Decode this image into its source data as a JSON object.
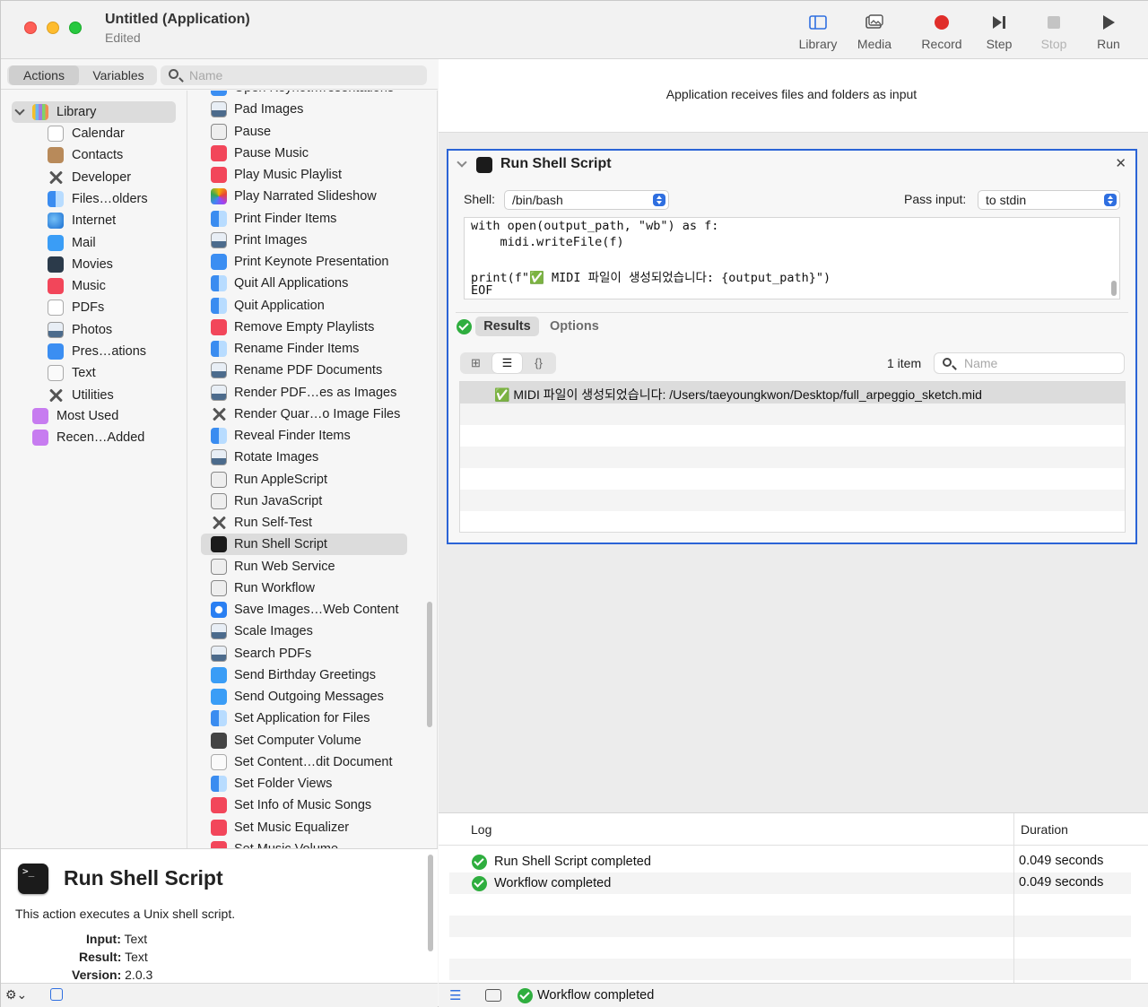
{
  "window": {
    "title": "Untitled (Application)",
    "subtitle": "Edited"
  },
  "toolbar": {
    "buttons": [
      {
        "label": "Library",
        "icon": "sidebar-icon",
        "enabled": true
      },
      {
        "label": "Media",
        "icon": "photo-icon",
        "enabled": true
      },
      {
        "label": "Record",
        "icon": "record-icon",
        "enabled": true
      },
      {
        "label": "Step",
        "icon": "step-icon",
        "enabled": true
      },
      {
        "label": "Stop",
        "icon": "stop-icon",
        "enabled": false
      },
      {
        "label": "Run",
        "icon": "play-icon",
        "enabled": true
      }
    ]
  },
  "left_tabs": {
    "actions": "Actions",
    "variables": "Variables",
    "search_placeholder": "Name"
  },
  "library": {
    "root": "Library",
    "items": [
      {
        "label": "Calendar",
        "icon": "calendar-icon"
      },
      {
        "label": "Contacts",
        "icon": "contacts-icon"
      },
      {
        "label": "Developer",
        "icon": "tools-icon"
      },
      {
        "label": "Files…olders",
        "icon": "finder-icon"
      },
      {
        "label": "Internet",
        "icon": "globe-icon"
      },
      {
        "label": "Mail",
        "icon": "mail-icon"
      },
      {
        "label": "Movies",
        "icon": "movies-icon"
      },
      {
        "label": "Music",
        "icon": "music-icon"
      },
      {
        "label": "PDFs",
        "icon": "pdf-icon"
      },
      {
        "label": "Photos",
        "icon": "photos-icon"
      },
      {
        "label": "Pres…ations",
        "icon": "keynote-icon"
      },
      {
        "label": "Text",
        "icon": "text-icon"
      },
      {
        "label": "Utilities",
        "icon": "tools-icon"
      }
    ],
    "smart_folders": [
      {
        "label": "Most Used",
        "icon": "smart-folder-icon"
      },
      {
        "label": "Recen…Added",
        "icon": "smart-folder-icon"
      }
    ]
  },
  "actions": [
    {
      "label": "Open Keynot…resentations",
      "icon": "keynote"
    },
    {
      "label": "Pad Images",
      "icon": "img"
    },
    {
      "label": "Pause",
      "icon": "script"
    },
    {
      "label": "Pause Music",
      "icon": "music"
    },
    {
      "label": "Play Music Playlist",
      "icon": "music"
    },
    {
      "label": "Play Narrated Slideshow",
      "icon": "photos"
    },
    {
      "label": "Print Finder Items",
      "icon": "finder"
    },
    {
      "label": "Print Images",
      "icon": "img"
    },
    {
      "label": "Print Keynote Presentation",
      "icon": "keynote"
    },
    {
      "label": "Quit All Applications",
      "icon": "finder"
    },
    {
      "label": "Quit Application",
      "icon": "finder"
    },
    {
      "label": "Remove Empty Playlists",
      "icon": "music"
    },
    {
      "label": "Rename Finder Items",
      "icon": "finder"
    },
    {
      "label": "Rename PDF Documents",
      "icon": "img"
    },
    {
      "label": "Render PDF…es as Images",
      "icon": "img"
    },
    {
      "label": "Render Quar…o Image Files",
      "icon": "tools"
    },
    {
      "label": "Reveal Finder Items",
      "icon": "finder"
    },
    {
      "label": "Rotate Images",
      "icon": "img"
    },
    {
      "label": "Run AppleScript",
      "icon": "script"
    },
    {
      "label": "Run JavaScript",
      "icon": "script"
    },
    {
      "label": "Run Self-Test",
      "icon": "tools"
    },
    {
      "label": "Run Shell Script",
      "icon": "term",
      "selected": true
    },
    {
      "label": "Run Web Service",
      "icon": "script"
    },
    {
      "label": "Run Workflow",
      "icon": "script"
    },
    {
      "label": "Save Images…Web Content",
      "icon": "safari"
    },
    {
      "label": "Scale Images",
      "icon": "img"
    },
    {
      "label": "Search PDFs",
      "icon": "img"
    },
    {
      "label": "Send Birthday Greetings",
      "icon": "mail"
    },
    {
      "label": "Send Outgoing Messages",
      "icon": "mail"
    },
    {
      "label": "Set Application for Files",
      "icon": "finder"
    },
    {
      "label": "Set Computer Volume",
      "icon": "volume"
    },
    {
      "label": "Set Content…dit Document",
      "icon": "text"
    },
    {
      "label": "Set Folder Views",
      "icon": "finder"
    },
    {
      "label": "Set Info of Music Songs",
      "icon": "music"
    },
    {
      "label": "Set Music Equalizer",
      "icon": "music"
    },
    {
      "label": "Set Music Volume",
      "icon": "music"
    }
  ],
  "description": {
    "title": "Run Shell Script",
    "text": "This action executes a Unix shell script.",
    "input_label": "Input:",
    "input_value": "Text",
    "result_label": "Result:",
    "result_value": "Text",
    "version_label": "Version:",
    "version_value": "2.0.3"
  },
  "workflow_header": "Application receives files and folders as input",
  "action_box": {
    "title": "Run Shell Script",
    "shell_label": "Shell:",
    "shell_value": "/bin/bash",
    "pass_input_label": "Pass input:",
    "pass_input_value": "to stdin",
    "code_lines": [
      "with open(output_path, \"wb\") as f:",
      "    midi.writeFile(f)",
      "",
      "print(f\"✅ MIDI 파일이 생성되었습니다: {output_path}\")",
      "EOF"
    ],
    "tab_results": "Results",
    "tab_options": "Options",
    "item_count": "1 item",
    "search_placeholder": "Name",
    "result_rows": [
      "✅ MIDI 파일이 생성되었습니다: /Users/taeyoungkwon/Desktop/full_arpeggio_sketch.mid"
    ]
  },
  "log": {
    "col_log": "Log",
    "col_duration": "Duration",
    "rows": [
      {
        "text": "Run Shell Script completed",
        "duration": "0.049 seconds"
      },
      {
        "text": "Workflow completed",
        "duration": "0.049 seconds"
      }
    ]
  },
  "status": "Workflow completed",
  "colors": {
    "selection_border": "#2b64d6",
    "success": "#2fae3f",
    "record": "#e02e2a"
  }
}
